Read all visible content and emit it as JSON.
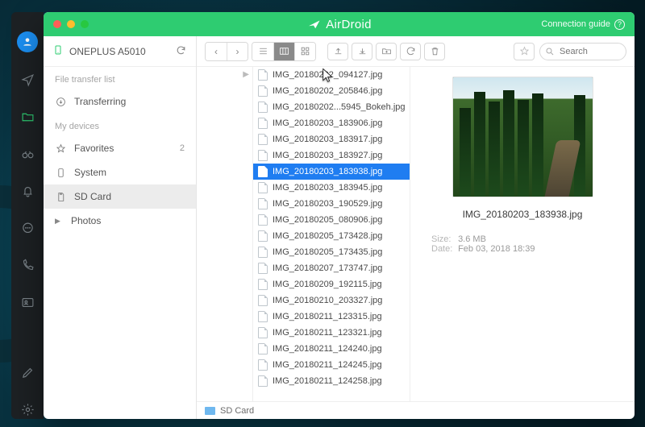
{
  "app": {
    "name": "AirDroid",
    "connection_guide": "Connection guide"
  },
  "window_controls": {
    "close": "close",
    "min": "minimize",
    "max": "maximize"
  },
  "leftrail": [
    {
      "id": "profile",
      "kind": "avatar"
    },
    {
      "id": "send",
      "kind": "paper-plane"
    },
    {
      "id": "files",
      "kind": "folder",
      "active": true
    },
    {
      "id": "remote",
      "kind": "binoculars"
    },
    {
      "id": "notify",
      "kind": "bell"
    },
    {
      "id": "chat",
      "kind": "message"
    },
    {
      "id": "call",
      "kind": "phone"
    },
    {
      "id": "contact",
      "kind": "user-card"
    }
  ],
  "leftrail_bottom": [
    {
      "id": "edit",
      "kind": "edit"
    },
    {
      "id": "settings",
      "kind": "gear"
    }
  ],
  "device": {
    "name": "ONEPLUS A5010"
  },
  "sidebar": {
    "section_transfer": "File transfer list",
    "transferring": "Transferring",
    "section_devices": "My devices",
    "favorites": {
      "label": "Favorites",
      "count": "2"
    },
    "system": "System",
    "sdcard": "SD Card",
    "photos": "Photos"
  },
  "toolbar": {
    "search_placeholder": "Search"
  },
  "files": [
    "IMG_20180202_094127.jpg",
    "IMG_20180202_205846.jpg",
    "IMG_20180202...5945_Bokeh.jpg",
    "IMG_20180203_183906.jpg",
    "IMG_20180203_183917.jpg",
    "IMG_20180203_183927.jpg",
    "IMG_20180203_183938.jpg",
    "IMG_20180203_183945.jpg",
    "IMG_20180203_190529.jpg",
    "IMG_20180205_080906.jpg",
    "IMG_20180205_173428.jpg",
    "IMG_20180205_173435.jpg",
    "IMG_20180207_173747.jpg",
    "IMG_20180209_192115.jpg",
    "IMG_20180210_203327.jpg",
    "IMG_20180211_123315.jpg",
    "IMG_20180211_123321.jpg",
    "IMG_20180211_124240.jpg",
    "IMG_20180211_124245.jpg",
    "IMG_20180211_124258.jpg"
  ],
  "selected_index": 6,
  "preview": {
    "name": "IMG_20180203_183938.jpg",
    "size_label": "Size:",
    "size": "3.6 MB",
    "date_label": "Date:",
    "date": "Feb 03, 2018 18:39"
  },
  "statusbar": {
    "path": "SD Card"
  }
}
